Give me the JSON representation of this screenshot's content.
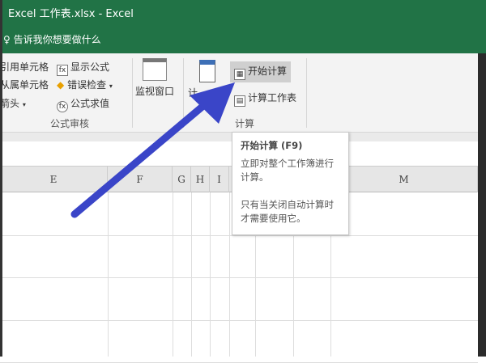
{
  "window": {
    "title": "Excel 工作表.xlsx  -  Excel",
    "tell_me": "告诉我你想要做什么"
  },
  "ribbon": {
    "audit": {
      "trace_precedents": "引用单元格",
      "trace_dependents": "从属单元格",
      "remove_arrows": "箭头",
      "show_formulas": "显示公式",
      "error_checking": "错误检查",
      "evaluate_formula": "公式求值",
      "group_label": "公式审核"
    },
    "watch_window": "监视窗口",
    "calc": {
      "options_partial": "计",
      "calc_now": "开始计算",
      "calc_sheet": "计算工作表",
      "group_label": "计算"
    }
  },
  "columns": [
    "E",
    "F",
    "G",
    "H",
    "I",
    "",
    "",
    "",
    "M"
  ],
  "tooltip": {
    "title": "开始计算 (F9)",
    "line1": "立即对整个工作簿进行计算。",
    "line2": "只有当关闭自动计算时才需要使用它。"
  },
  "annotation": {
    "arrow_color": "#3a45c8"
  },
  "colors": {
    "excel_green": "#217346"
  }
}
